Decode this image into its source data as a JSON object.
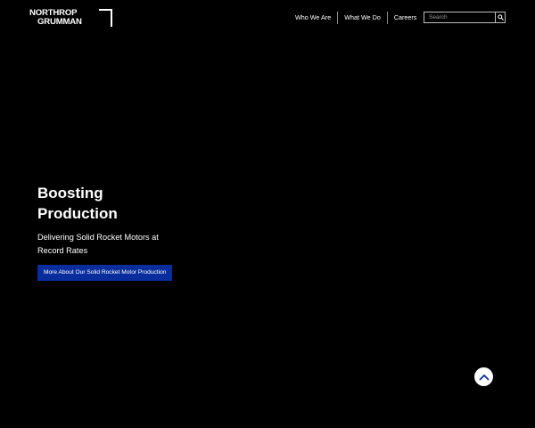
{
  "brand": {
    "logo_line1": "NORTHROP",
    "logo_line2": "GRUMMAN"
  },
  "nav": {
    "items": [
      {
        "label": "Who We Are"
      },
      {
        "label": "What We Do"
      },
      {
        "label": "Careers"
      }
    ]
  },
  "search": {
    "placeholder": "Search",
    "icon": "search-icon"
  },
  "hero": {
    "title": "Boosting Production",
    "subtitle": "Delivering Solid Rocket Motors at Record Rates",
    "cta_label": "More About Our Solid Rocket Motor Production"
  },
  "scroll_top": {
    "icon": "chevron-up-icon"
  },
  "colors": {
    "background": "#000000",
    "text": "#ffffff",
    "cta_background": "#0a2d9e",
    "divider": "#8a8a8a"
  }
}
